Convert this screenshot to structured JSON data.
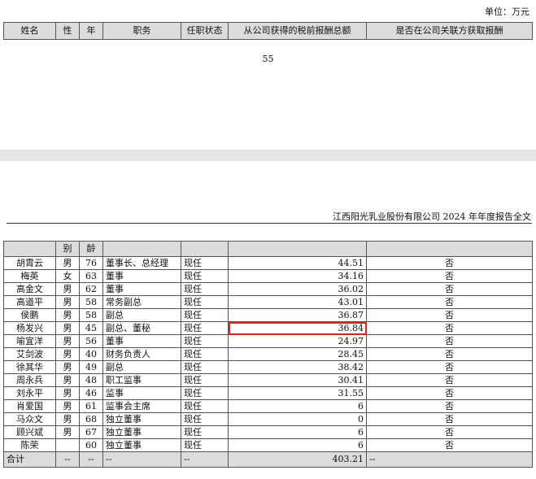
{
  "unit_label": "单位：万元",
  "top_headers": [
    "姓名",
    "性",
    "年",
    "职务",
    "任职状态",
    "从公司获得的税前报酬总额",
    "是否在公司关联方获取报酬"
  ],
  "page_number": "55",
  "doc_header": "江西阳光乳业股份有限公司 2024 年年度报告全文",
  "cont_headers": [
    "",
    "别",
    "龄",
    "",
    "",
    "",
    ""
  ],
  "rows": [
    {
      "name": "胡霄云",
      "gender": "男",
      "age": "76",
      "title": "董事长、总经理",
      "status": "现任",
      "pay": "44.51",
      "related": "否"
    },
    {
      "name": "梅英",
      "gender": "女",
      "age": "63",
      "title": "董事",
      "status": "现任",
      "pay": "34.16",
      "related": "否"
    },
    {
      "name": "高金文",
      "gender": "男",
      "age": "62",
      "title": "董事",
      "status": "现任",
      "pay": "36.02",
      "related": "否"
    },
    {
      "name": "高道平",
      "gender": "男",
      "age": "58",
      "title": "常务副总",
      "status": "现任",
      "pay": "43.01",
      "related": "否"
    },
    {
      "name": "侯鹏",
      "gender": "男",
      "age": "58",
      "title": "副总",
      "status": "现任",
      "pay": "36.87",
      "related": "否"
    },
    {
      "name": "杨发兴",
      "gender": "男",
      "age": "45",
      "title": "副总、董秘",
      "status": "现任",
      "pay": "36.84",
      "related": "否"
    },
    {
      "name": "喻宜洋",
      "gender": "男",
      "age": "56",
      "title": "董事",
      "status": "现任",
      "pay": "24.97",
      "related": "否"
    },
    {
      "name": "艾剑波",
      "gender": "男",
      "age": "40",
      "title": "财务负责人",
      "status": "现任",
      "pay": "28.45",
      "related": "否"
    },
    {
      "name": "徐其华",
      "gender": "男",
      "age": "49",
      "title": "副总",
      "status": "现任",
      "pay": "38.42",
      "related": "否"
    },
    {
      "name": "周永兵",
      "gender": "男",
      "age": "48",
      "title": "职工监事",
      "status": "现任",
      "pay": "30.41",
      "related": "否"
    },
    {
      "name": "刘永平",
      "gender": "男",
      "age": "46",
      "title": "监事",
      "status": "现任",
      "pay": "31.55",
      "related": "否"
    },
    {
      "name": "肖爱国",
      "gender": "男",
      "age": "61",
      "title": "监事会主席",
      "status": "现任",
      "pay": "6",
      "related": "否"
    },
    {
      "name": "马众文",
      "gender": "男",
      "age": "68",
      "title": "独立董事",
      "status": "现任",
      "pay": "0",
      "related": "否"
    },
    {
      "name": "顾兴斌",
      "gender": "男",
      "age": "67",
      "title": "独立董事",
      "status": "现任",
      "pay": "6",
      "related": "否"
    },
    {
      "name": "陈荣",
      "gender": "",
      "age": "60",
      "title": "独立董事",
      "status": "现任",
      "pay": "6",
      "related": "否"
    }
  ],
  "total": {
    "label": "合计",
    "gender": "--",
    "age": "--",
    "title": "--",
    "status": "--",
    "pay": "403.21",
    "related": "--"
  },
  "highlight_row_index": 5,
  "highlight_color": "#e0241b"
}
